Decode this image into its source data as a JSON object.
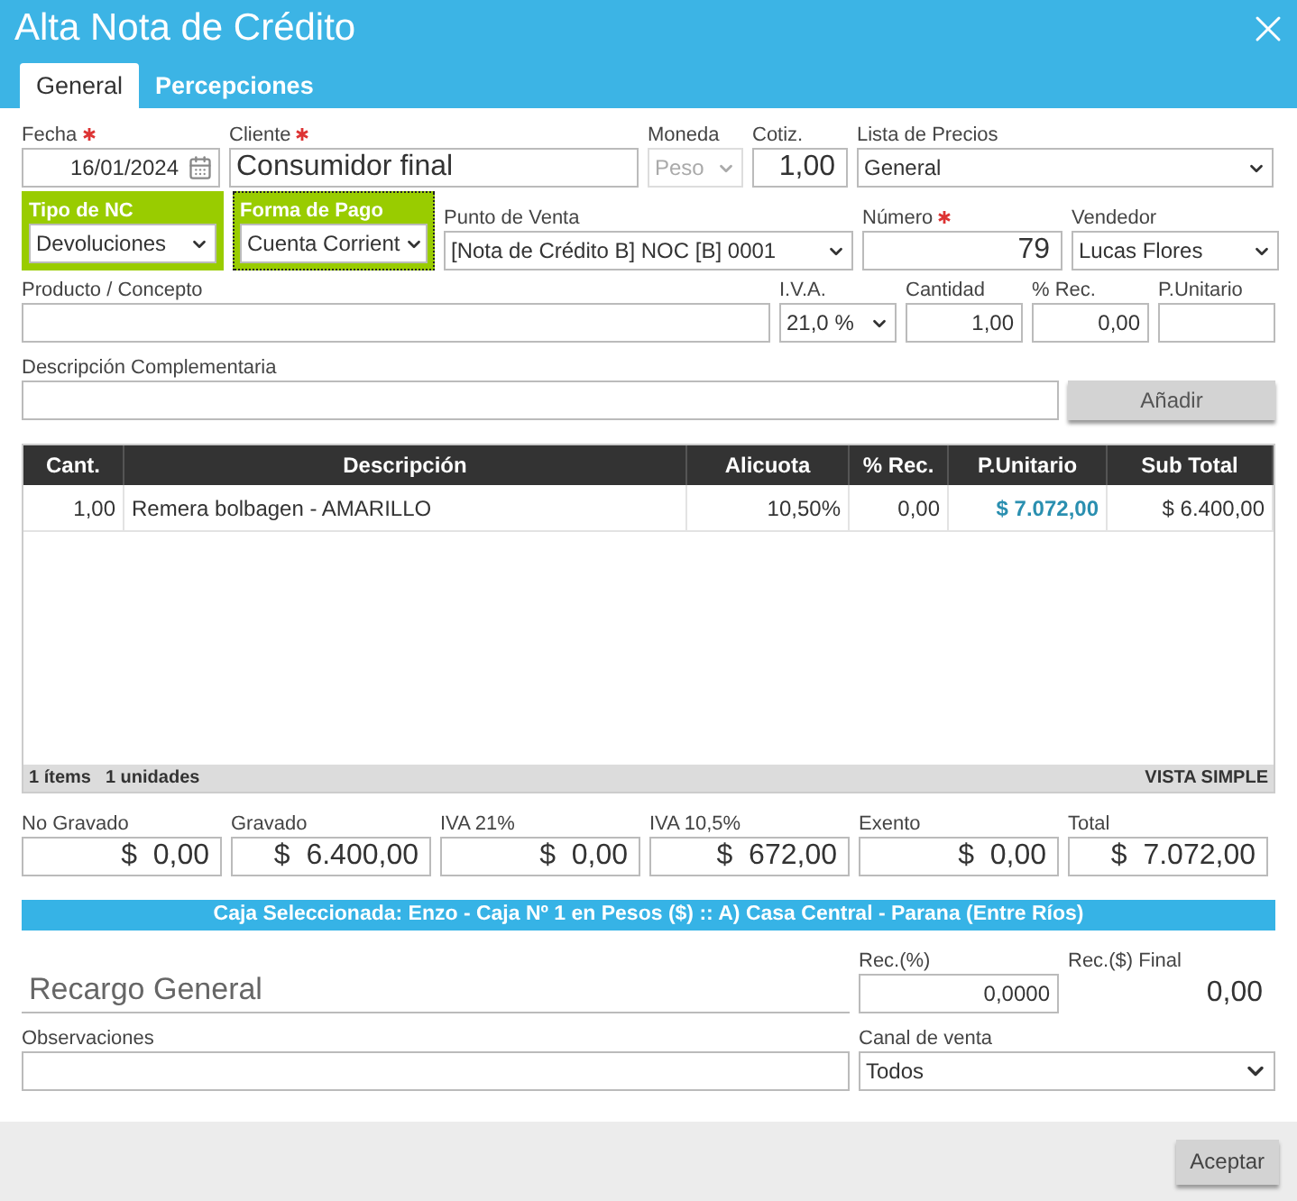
{
  "window": {
    "title": "Alta Nota de Crédito"
  },
  "tabs": [
    {
      "label": "General",
      "selected": true
    },
    {
      "label": "Percepciones",
      "selected": false
    }
  ],
  "form_rows": [
    [
      {
        "kind": "date",
        "label": "Fecha",
        "required": true,
        "value": "16/01/2024",
        "disabled": false
      },
      {
        "kind": "big-text",
        "label": "Cliente",
        "required": true,
        "value": "Consumidor final",
        "disabled": false
      },
      {
        "kind": "select",
        "label": "Moneda",
        "required": false,
        "value": "Peso",
        "disabled": true
      },
      {
        "kind": "big-number",
        "label": "Cotiz.",
        "required": false,
        "value": "1,00",
        "disabled": false
      },
      {
        "kind": "select",
        "label": "Lista de Precios",
        "required": false,
        "value": "General",
        "disabled": false
      }
    ],
    [
      {
        "kind": "select",
        "label": "Tipo de NC",
        "required": false,
        "value": "Devoluciones",
        "highlighted": true,
        "focused": false
      },
      {
        "kind": "select",
        "label": "Forma de Pago",
        "required": false,
        "value": "Cuenta Corrient",
        "highlighted": true,
        "focused": true
      },
      {
        "kind": "select",
        "label": "Punto de Venta",
        "required": false,
        "value": "[Nota de Crédito B] NOC [B] 0001",
        "highlighted": false,
        "focused": false
      },
      {
        "kind": "big-number",
        "label": "Número",
        "required": true,
        "value": "79",
        "highlighted": false,
        "focused": false
      },
      {
        "kind": "select",
        "label": "Vendedor",
        "required": false,
        "value": "Lucas Flores",
        "highlighted": false,
        "focused": false
      }
    ],
    [
      {
        "kind": "text",
        "label": "Producto / Concepto",
        "required": false
      },
      {
        "kind": "select",
        "label": "I.V.A.",
        "required": false,
        "value": "21,0 %"
      },
      {
        "kind": "number",
        "label": "Cantidad",
        "required": false,
        "value": "1,00"
      },
      {
        "kind": "number",
        "label": "% Rec.",
        "required": false,
        "value": "0,00"
      },
      {
        "kind": "number",
        "label": "P.Unitario",
        "required": false
      }
    ],
    [
      {
        "kind": "text",
        "label": "Descripción Complementaria",
        "required": false
      },
      {
        "kind": "button",
        "value": "Añadir"
      }
    ]
  ],
  "table": {
    "columns": [
      "Cant.",
      "Descripción",
      "Alicuota",
      "% Rec.",
      "P.Unitario",
      "Sub Total"
    ],
    "rows": [
      [
        "1,00",
        "Remera bolbagen - AMARILLO",
        "10,50%",
        "0,00",
        "$ 7.072,00",
        "$ 6.400,00"
      ]
    ],
    "summary": [
      "1 ítems",
      "1 unidades"
    ],
    "view_link": "VISTA SIMPLE"
  },
  "totals": [
    {
      "label": "No Gravado",
      "value": "$  0,00"
    },
    {
      "label": "Gravado",
      "value": "$  6.400,00"
    },
    {
      "label": "IVA 21%",
      "value": "$  0,00"
    },
    {
      "label": "IVA 10,5%",
      "value": "$  672,00"
    },
    {
      "label": "Exento",
      "value": "$  0,00"
    },
    {
      "label": "Total",
      "value": "$  7.072,00"
    }
  ],
  "cash_register": "Caja Seleccionada: Enzo - Caja Nº 1 en Pesos ($) :: A) Casa Central - Parana (Entre Ríos)",
  "surcharge": {
    "placeholder": "Recargo General",
    "percent_label": "Rec.(%)",
    "percent": "0,0000",
    "final_label": "Rec.($) Final",
    "final": "0,00"
  },
  "notes": {
    "label": "Observaciones"
  },
  "channel": {
    "label": "Canal de venta",
    "value": "Todos"
  },
  "footer": {
    "button": "Aceptar"
  }
}
